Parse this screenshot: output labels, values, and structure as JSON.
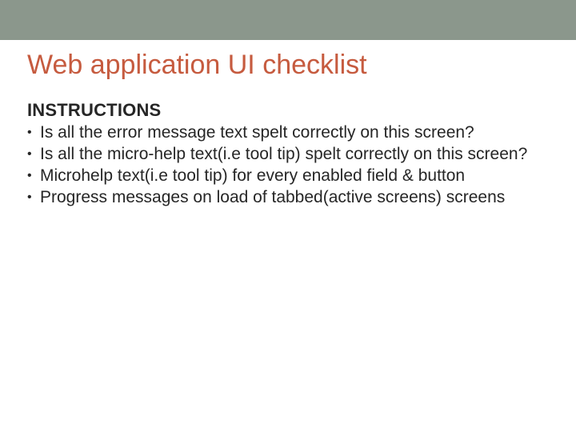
{
  "slide": {
    "title": "Web application UI checklist",
    "section_heading": "INSTRUCTIONS",
    "bullets": [
      "Is all the error message text spelt correctly on this screen?",
      "Is all the micro-help text(i.e tool tip) spelt correctly on this screen?",
      "Microhelp text(i.e tool tip) for every enabled field & button",
      "Progress messages on load of tabbed(active screens) screens"
    ]
  },
  "colors": {
    "top_bar": "#8b978c",
    "title": "#c65b3f",
    "text": "#262626"
  }
}
